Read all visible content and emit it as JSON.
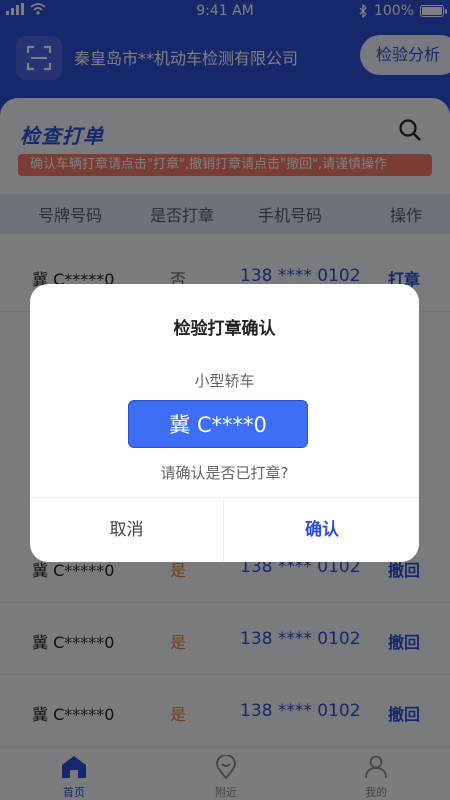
{
  "status": {
    "time": "9:41 AM",
    "battery": "100%"
  },
  "header": {
    "company": "秦皇岛市**机动车检测有限公司",
    "analysis_label": "检验分析"
  },
  "page": {
    "title": "检查打单",
    "notice": "确认车辆打章请点击\"打章\",撤销打章请点击\"撤回\",请谨慎操作"
  },
  "table": {
    "headers": [
      "号牌号码",
      "是否打章",
      "手机号码",
      "操作"
    ],
    "rows": [
      {
        "plate": "冀 C*****0",
        "stamped": "否",
        "phone": "138 **** 0102",
        "action": "打章"
      },
      {
        "plate": "冀 C*****0",
        "stamped": "是",
        "phone": "138 **** 0102",
        "action": "撤回"
      },
      {
        "plate": "冀 C*****0",
        "stamped": "是",
        "phone": "138 **** 0102",
        "action": "撤回"
      },
      {
        "plate": "冀 C*****0",
        "stamped": "是",
        "phone": "138 **** 0102",
        "action": "撤回"
      }
    ]
  },
  "tabs": [
    {
      "label": "首页",
      "icon": "home-icon"
    },
    {
      "label": "附近",
      "icon": "location-pin-icon"
    },
    {
      "label": "我的",
      "icon": "user-icon"
    }
  ],
  "dialog": {
    "title": "检验打章确认",
    "vehicle_type": "小型轿车",
    "plate": "冀 C****0",
    "question": "请确认是否已打章?",
    "cancel_label": "取消",
    "confirm_label": "确认"
  },
  "colors": {
    "primary": "#2f4fd8",
    "notice": "#f37b6b",
    "stamped_yes": "#e0883a"
  }
}
